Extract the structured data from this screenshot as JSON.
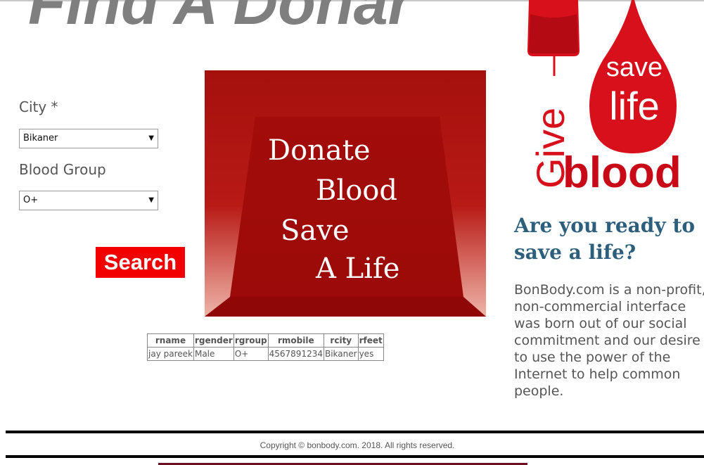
{
  "page": {
    "heading": "Find A Donar"
  },
  "form": {
    "city_label": "City *",
    "city_value": "Bikaner",
    "blood_group_label": "Blood Group",
    "blood_group_value": "O+",
    "search_label": "Search"
  },
  "banner": {
    "lines": [
      "Donate",
      "Blood",
      "Save",
      "A Life"
    ]
  },
  "results": {
    "columns": [
      "rname",
      "rgender",
      "rgroup",
      "rmobile",
      "rcity",
      "rfeet"
    ],
    "rows": [
      [
        "jay pareek",
        "Male",
        "O+",
        "4567891234",
        "Bikaner",
        "yes"
      ]
    ]
  },
  "poster": {
    "save_text": "save",
    "life_text": "life",
    "give_text": "Give",
    "blood_text": "blood"
  },
  "sidebar": {
    "title": "Are you ready to save a life?",
    "description": "BonBody.com is a non-profit, non-commercial interface was born out of our social commitment and our desire to use the power of the Internet to help common people."
  },
  "footer": {
    "copyright": "Copyright © bonbody.com. 2018. All rights reserved."
  },
  "colors": {
    "accent_red": "#f20000",
    "banner_red": "#a8100e",
    "heading_gray": "#7f7f7f",
    "title_blue": "#2d5f7c"
  }
}
